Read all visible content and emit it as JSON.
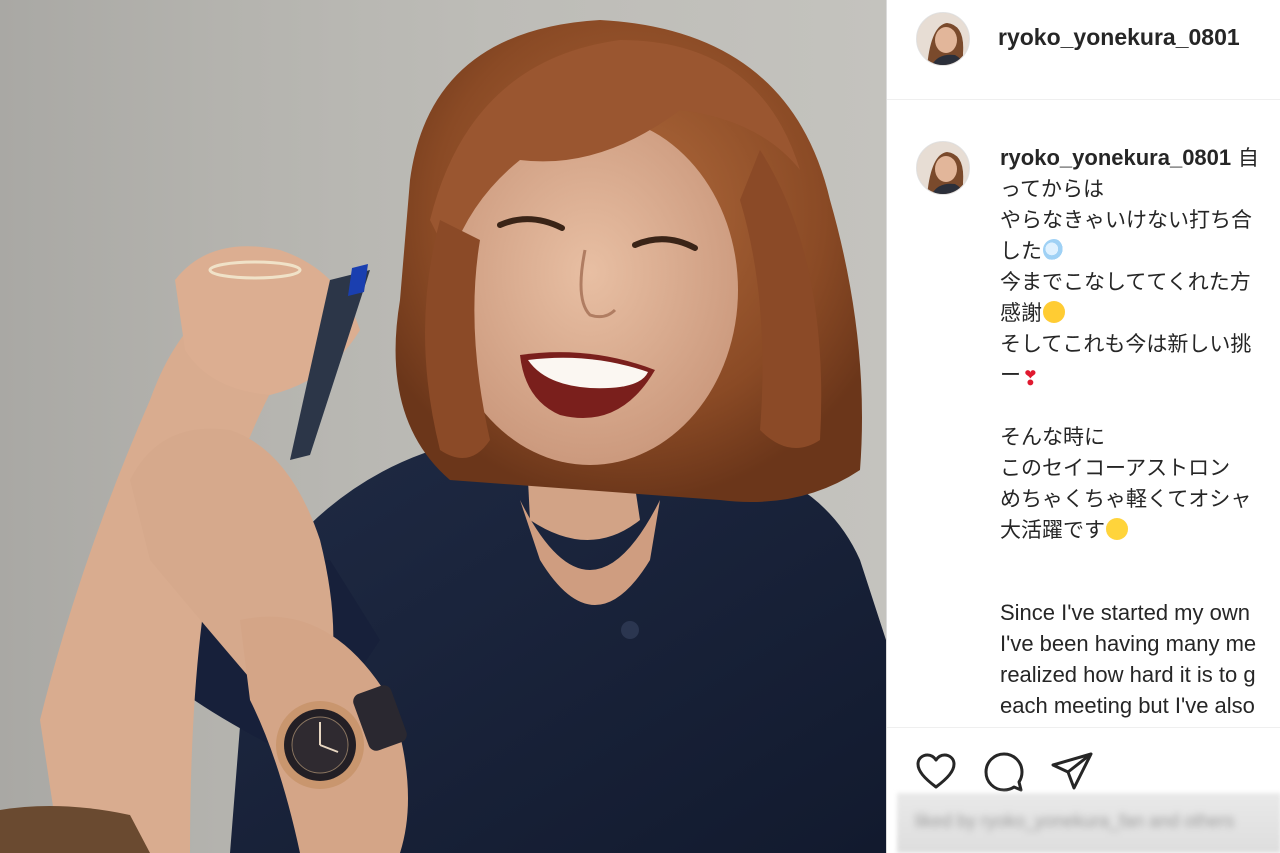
{
  "post": {
    "username": "ryoko_yonekura_0801",
    "photo_alt": "Woman with short auburn hair smiling, wearing a navy shirt and a rose-gold wristwatch"
  },
  "caption": {
    "username": "ryoko_yonekura_0801",
    "lines_jp": [
      "自",
      "ってからは",
      "やらなきゃいけない打ち合",
      "した",
      "今までこなしててくれた方",
      "感謝",
      "そしてこれも今は新しい挑",
      "ー",
      "そんな時に",
      "このセイコーアストロン",
      "めちゃくちゃ軽くてオシャ",
      "大活躍です"
    ],
    "lines_en": [
      "Since I've started my own",
      "I've been having many me",
      "realized how hard it is to g",
      "each meeting but I've also"
    ],
    "emoji": {
      "dash": "dash-emoji",
      "laugh": "rolling-laughing-emoji",
      "heart": "❣",
      "yum": "yum-emoji"
    }
  },
  "actions": {
    "like": "heart-icon",
    "comment": "comment-icon",
    "share": "paper-plane-icon"
  },
  "likes_blurred": "liked by ryoko_yonekura_fan and others"
}
